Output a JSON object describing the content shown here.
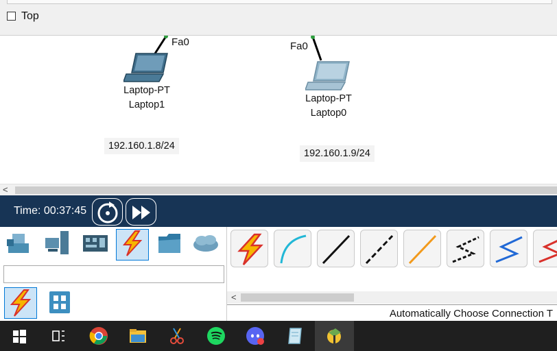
{
  "top_panel": {
    "top_checkbox_label": "Top",
    "top_checked": false
  },
  "workspace": {
    "devices": [
      {
        "model": "Laptop-PT",
        "name": "Laptop1",
        "port": "Fa0",
        "ip": "192.160.1.8/24"
      },
      {
        "model": "Laptop-PT",
        "name": "Laptop0",
        "port": "Fa0",
        "ip": "192.160.1.9/24"
      }
    ],
    "link_light_color": "#2e9e3e"
  },
  "timebar": {
    "time_label": "Time: 00:37:45",
    "background": "#173455"
  },
  "device_panel": {
    "categories": [
      "network-devices-icon",
      "end-devices-icon",
      "components-icon",
      "connections-icon",
      "miscellaneous-icon",
      "multiuser-icon"
    ],
    "selected_category": "connections-icon",
    "search_value": "",
    "subcategories": [
      "connections-icon",
      "grid-icon"
    ]
  },
  "connections_panel": {
    "types": [
      "automatic-connection-icon",
      "console-cable-icon",
      "copper-straight-through-icon",
      "copper-cross-over-icon",
      "fiber-icon",
      "phone-cable-icon",
      "serial-dce-icon",
      "serial-dte-icon"
    ],
    "status_text": "Automatically Choose Connection T"
  },
  "taskbar": {
    "icons": [
      "windows-start-icon",
      "task-view-icon",
      "chrome-icon",
      "file-explorer-icon",
      "snipping-tool-icon",
      "spotify-icon",
      "discord-icon",
      "notepad-icon",
      "packet-tracer-icon"
    ],
    "active_icon": "packet-tracer-icon"
  }
}
